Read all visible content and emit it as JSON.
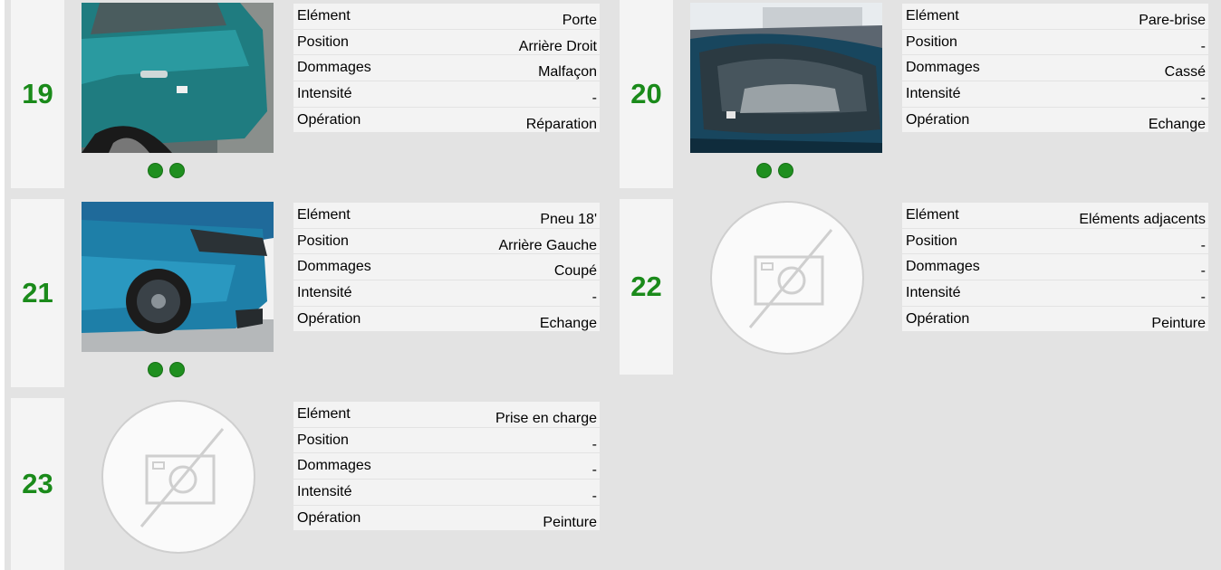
{
  "items": [
    {
      "number": "19",
      "rows": [
        {
          "label": "Elément",
          "value": "Porte"
        },
        {
          "label": "Position",
          "value": "Arrière Droit"
        },
        {
          "label": "Dommages",
          "value": "Malfaçon"
        },
        {
          "label": "Intensité",
          "value": "-"
        },
        {
          "label": "Opération",
          "value": "Réparation"
        }
      ]
    },
    {
      "number": "20",
      "rows": [
        {
          "label": "Elément",
          "value": "Pare-brise"
        },
        {
          "label": "Position",
          "value": "-"
        },
        {
          "label": "Dommages",
          "value": "Cassé"
        },
        {
          "label": "Intensité",
          "value": "-"
        },
        {
          "label": "Opération",
          "value": "Echange"
        }
      ]
    },
    {
      "number": "21",
      "rows": [
        {
          "label": "Elément",
          "value": "Pneu 18'"
        },
        {
          "label": "Position",
          "value": "Arrière Gauche"
        },
        {
          "label": "Dommages",
          "value": "Coupé"
        },
        {
          "label": "Intensité",
          "value": "-"
        },
        {
          "label": "Opération",
          "value": "Echange"
        }
      ]
    },
    {
      "number": "22",
      "rows": [
        {
          "label": "Elément",
          "value": "Eléments adjacents"
        },
        {
          "label": "Position",
          "value": "-"
        },
        {
          "label": "Dommages",
          "value": "-"
        },
        {
          "label": "Intensité",
          "value": "-"
        },
        {
          "label": "Opération",
          "value": "Peinture"
        }
      ]
    },
    {
      "number": "23",
      "rows": [
        {
          "label": "Elément",
          "value": "Prise en charge"
        },
        {
          "label": "Position",
          "value": "-"
        },
        {
          "label": "Dommages",
          "value": "-"
        },
        {
          "label": "Intensité",
          "value": "-"
        },
        {
          "label": "Opération",
          "value": "Peinture"
        }
      ]
    }
  ],
  "colors": {
    "number": "#1a8a1a",
    "dot": "#1f8f1f",
    "background": "#e3e3e3",
    "row": "#f3f3f3"
  },
  "icons": {
    "no_photo": "camera-off-icon",
    "carousel_dot": "carousel-dot-icon"
  }
}
